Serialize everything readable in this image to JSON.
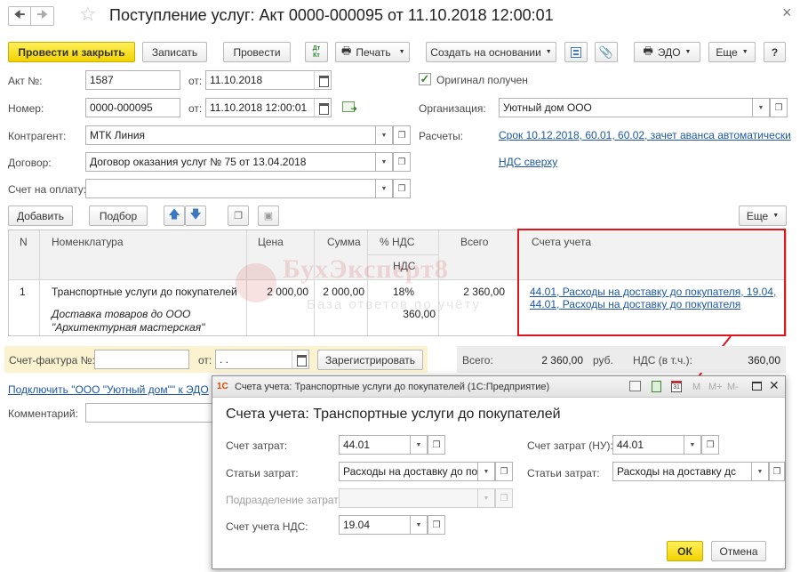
{
  "window": {
    "title": "Поступление услуг: Акт 0000-000095 от 11.10.2018 12:00:01",
    "close": "×"
  },
  "toolbar": {
    "post_close": "Провести и закрыть",
    "save": "Записать",
    "post": "Провести",
    "dtkt": "Дт Кт",
    "print": "Печать",
    "create_based": "Создать на основании",
    "edo": "ЭДО",
    "more": "Еще",
    "help": "?"
  },
  "form": {
    "act_label": "Акт №:",
    "act_value": "1587",
    "from_label": "от:",
    "act_date": "11.10.2018",
    "number_label": "Номер:",
    "number_value": "0000-000095",
    "number_date": "11.10.2018 12:00:01",
    "original_label": "Оригинал получен",
    "org_label": "Организация:",
    "org_value": "Уютный дом ООО",
    "contractor_label": "Контрагент:",
    "contractor_value": "МТК Линия",
    "payments_label": "Расчеты:",
    "payments_link": "Срок 10.12.2018, 60.01, 60.02, зачет аванса автоматически",
    "contract_label": "Договор:",
    "contract_value": "Договор оказания услуг № 75 от 13.04.2018",
    "vat_link": "НДС сверху",
    "invoice_label": "Счет на оплату:"
  },
  "table_toolbar": {
    "add": "Добавить",
    "pick": "Подбор",
    "more": "Еще"
  },
  "table": {
    "headers": {
      "n": "N",
      "item": "Номенклатура",
      "price": "Цена",
      "sum": "Сумма",
      "vat_pct": "% НДС",
      "vat": "НДС",
      "total": "Всего",
      "accounts": "Счета учета"
    },
    "row": {
      "n": "1",
      "item": "Транспортные услуги до покупателей",
      "item_desc1": "Доставка товаров до ООО",
      "item_desc2": "\"Архитектурная мастерская\"",
      "price": "2 000,00",
      "sum": "2 000,00",
      "vat_pct": "18%",
      "vat": "360,00",
      "total": "2 360,00",
      "accounts_line1": "44.01, Расходы на доставку до покупателя, 19.04,",
      "accounts_line2": "44.01, Расходы на доставку до покупателя"
    }
  },
  "watermark": {
    "title": "БухЭксперт8",
    "subtitle": "База ответов по учёту"
  },
  "bottom": {
    "sf_label": "Счет-фактура №:",
    "from_label": "от:",
    "sf_date": " .  .",
    "register": "Зарегистрировать",
    "total_label": "Всего:",
    "total_value": "2 360,00",
    "currency": "руб.",
    "vat_label": "НДС (в т.ч.):",
    "vat_value": "360,00",
    "connect_link": "Подключить \"ООО \"Уютный дом\"\" к ЭДО",
    "comment_label": "Комментарий:"
  },
  "dialog": {
    "titlebar": "Счета учета: Транспортные услуги до покупателей (1С:Предприятие)",
    "heading": "Счета учета: Транспортные услуги до покупателей",
    "cost_account_label": "Счет затрат:",
    "cost_account_value": "44.01",
    "cost_account_nu_label": "Счет затрат (НУ):",
    "cost_account_nu_value": "44.01",
    "cost_items_label": "Статьи затрат:",
    "cost_items_value": "Расходы на доставку до пок",
    "cost_items_nu_label": "Статьи затрат:",
    "cost_items_nu_value": "Расходы на доставку дс",
    "division_label": "Подразделение затрат:",
    "vat_account_label": "Счет учета НДС:",
    "vat_account_value": "19.04",
    "ok": "ОК",
    "cancel": "Отмена",
    "m_buttons": [
      "M",
      "M+",
      "M-"
    ],
    "logo": "1С"
  },
  "colors": {
    "accent_yellow": "#f2d200",
    "highlight_red": "#e0141c",
    "link_blue": "#1c57a4",
    "sf_panel": "#fbf3cf",
    "total_panel": "#ececec"
  }
}
